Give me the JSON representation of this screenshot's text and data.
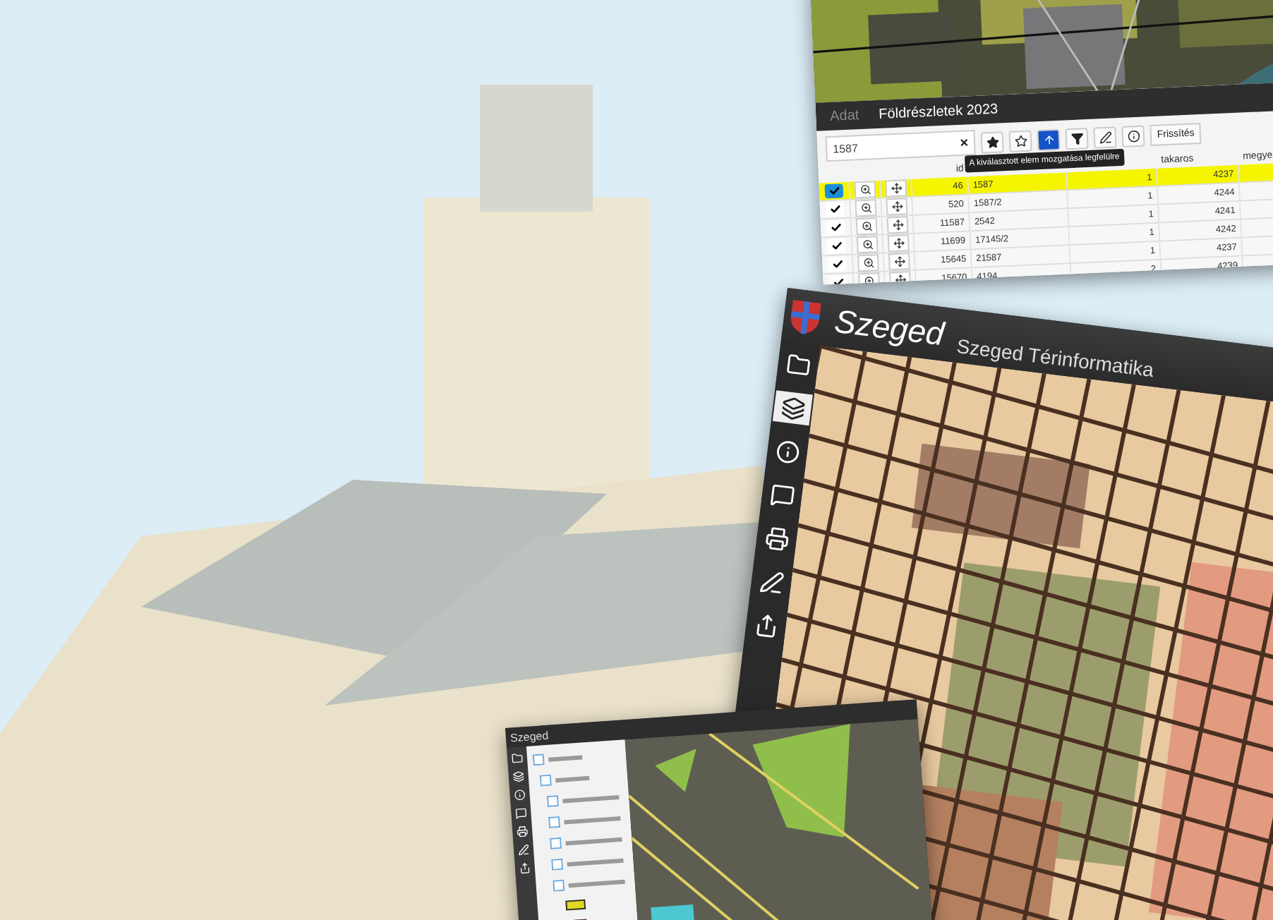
{
  "data_window": {
    "tabs": [
      {
        "label": "Adat",
        "selected": false
      },
      {
        "label": "Földrészletek 2023",
        "selected": true
      }
    ],
    "search": {
      "value": "1587",
      "clear": "×"
    },
    "refresh_button": "Frissítés",
    "tooltip": "A kiválasztott elem mozgatása legfelülre",
    "headers": {
      "id": "id",
      "takaros": "takaros",
      "megye": "megye"
    },
    "rows": [
      {
        "id": "46",
        "column_2": "1587",
        "column_3": "1",
        "takaros": "4237",
        "checked": true,
        "selected": true
      },
      {
        "id": "520",
        "column_2": "1587/2",
        "column_3": "1",
        "takaros": "4244",
        "checked": true,
        "selected": false
      },
      {
        "id": "11587",
        "column_2": "2542",
        "column_3": "1",
        "takaros": "4241",
        "checked": true,
        "selected": false
      },
      {
        "id": "11699",
        "column_2": "17145/2",
        "column_3": "1",
        "takaros": "4242",
        "checked": true,
        "selected": false
      },
      {
        "id": "15645",
        "column_2": "21587",
        "column_3": "1",
        "takaros": "4237",
        "checked": true,
        "selected": false
      },
      {
        "id": "15670",
        "column_2": "4194",
        "column_3": "2",
        "takaros": "4239",
        "checked": true,
        "selected": false
      }
    ]
  },
  "map_window": {
    "logo_text": "Szeged",
    "title": "Szeged Térinformatika"
  },
  "small_window": {
    "logo_text": "Szeged"
  }
}
